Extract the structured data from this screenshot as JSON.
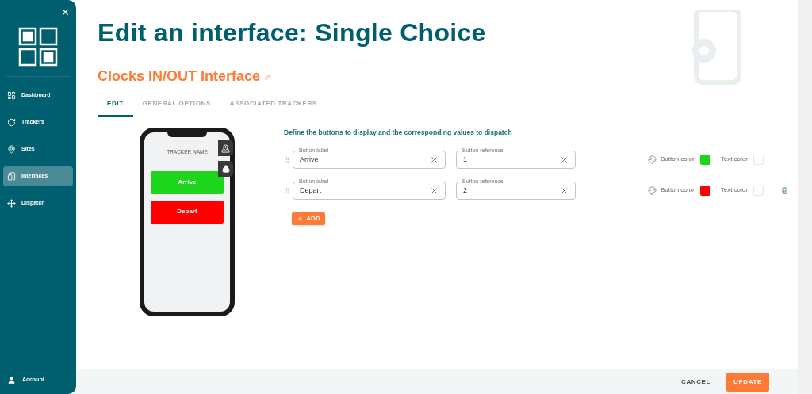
{
  "sidebar": {
    "close": "×",
    "items": [
      {
        "label": "Dashboard",
        "selected": false
      },
      {
        "label": "Trackers",
        "selected": false
      },
      {
        "label": "Sites",
        "selected": false
      },
      {
        "label": "Interfaces",
        "selected": true
      },
      {
        "label": "Dispatch",
        "selected": false
      }
    ],
    "account": "Account"
  },
  "title": "Edit an interface: Single Choice",
  "interface_name": "Clocks IN/OUT Interface",
  "tabs": [
    {
      "label": "EDIT",
      "selected": true
    },
    {
      "label": "GENERAL OPTIONS",
      "selected": false
    },
    {
      "label": "ASSOCIATED TRACKERS",
      "selected": false
    }
  ],
  "phone": {
    "tracker_name": "TRACKER NAME",
    "buttons": [
      {
        "label": "Arrive",
        "color": "#1ed51e"
      },
      {
        "label": "Depart",
        "color": "#ff0000"
      }
    ]
  },
  "instructions": "Define the buttons to display and the corresponding values to dispatch",
  "rows": [
    {
      "label_caption": "Button label",
      "label_value": "Arrive",
      "ref_caption": "Button reference",
      "ref_value": "1",
      "button_color_label": "Button color",
      "color": "#1ed51e",
      "text_color_label": "Text color",
      "removable": false
    },
    {
      "label_caption": "Button label",
      "label_value": "Depart",
      "ref_caption": "Button reference",
      "ref_value": "2",
      "button_color_label": "Button color",
      "color": "#ff0000",
      "text_color_label": "Text color",
      "removable": true
    }
  ],
  "add_button": "ADD",
  "footer": {
    "cancel": "CANCEL",
    "update": "UPDATE"
  }
}
